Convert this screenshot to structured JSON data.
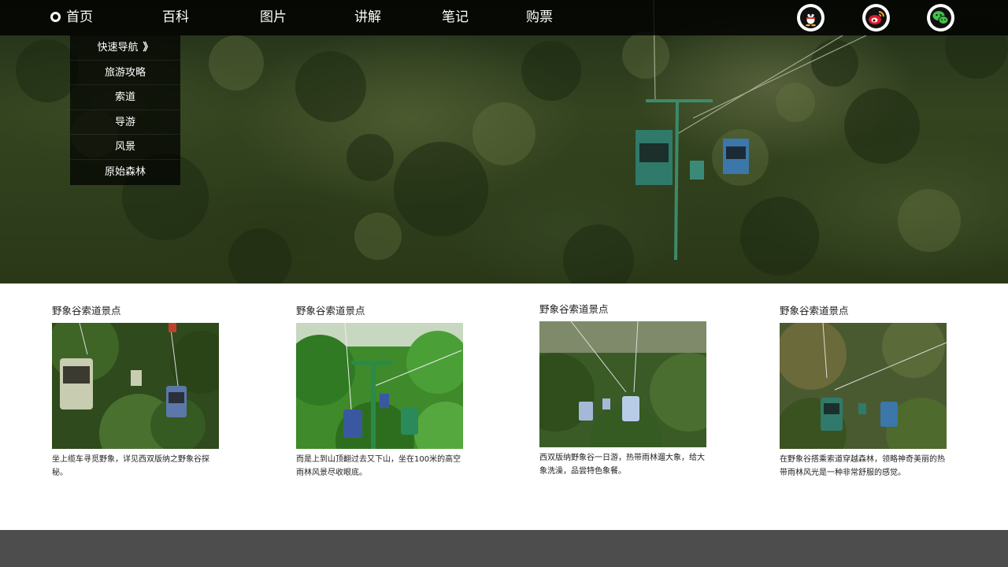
{
  "nav": {
    "items": [
      {
        "label": "首页",
        "active": true
      },
      {
        "label": "百科"
      },
      {
        "label": "图片"
      },
      {
        "label": "讲解"
      },
      {
        "label": "笔记"
      },
      {
        "label": "购票"
      }
    ],
    "social_icons": [
      "qq-icon",
      "weibo-icon",
      "wechat-icon"
    ]
  },
  "dropdown": {
    "items": [
      {
        "label": "快速导航",
        "arrow": "》"
      },
      {
        "label": "旅游攻略"
      },
      {
        "label": "索道"
      },
      {
        "label": "导游"
      },
      {
        "label": "风景"
      },
      {
        "label": "原始森林"
      }
    ]
  },
  "cards": [
    {
      "title": "野象谷索道景点",
      "text": "坐上缆车寻觅野象，详见西双版纳之野象谷探秘。"
    },
    {
      "title": "野象谷索道景点",
      "text": "而是上到山顶翻过去又下山，坐在100米的高空雨林风景尽收眼底。"
    },
    {
      "title": "野象谷索道景点",
      "text": "西双版纳野象谷一日游，热带雨林遛大象，给大象洗澡，品尝特色象餐。"
    },
    {
      "title": "野象谷索道景点",
      "text": "在野象谷搭乘索道穿越森林，领略神奇美丽的热带雨林风光是一种非常舒服的感觉。"
    }
  ],
  "colors": {
    "nav_bg": "#000000",
    "footer_bg": "#4d4d4d",
    "text": "#222222"
  }
}
